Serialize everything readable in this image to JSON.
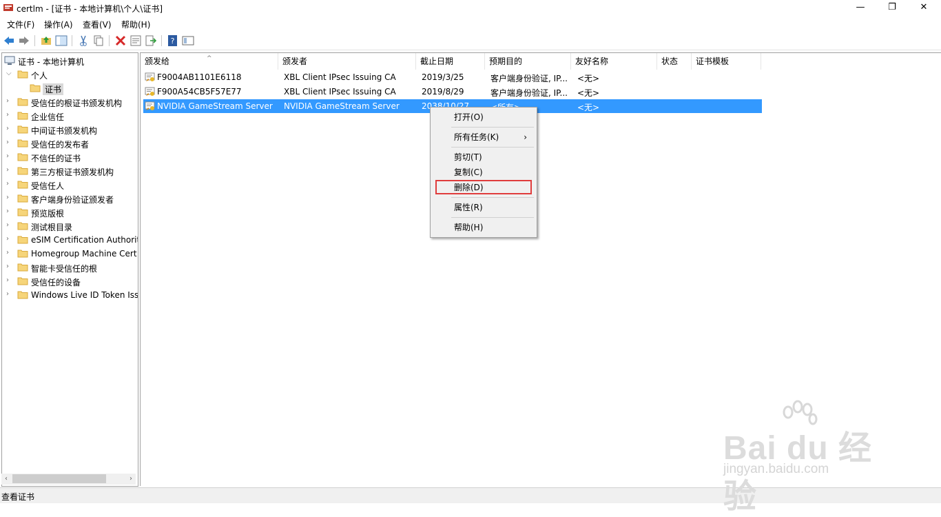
{
  "window": {
    "title": "certlm - [证书 - 本地计算机\\个人\\证书]",
    "minimize_glyph": "—",
    "restore_glyph": "❐",
    "close_glyph": "✕"
  },
  "menu": [
    "文件(F)",
    "操作(A)",
    "查看(V)",
    "帮助(H)"
  ],
  "toolbar": {
    "icons": [
      "back-arrow-icon",
      "forward-arrow-icon",
      "up-folder-icon",
      "show-hide-tree-icon",
      "cut-icon",
      "copy-icon",
      "delete-icon",
      "properties-icon",
      "export-list-icon",
      "help-icon",
      "console-icon"
    ]
  },
  "tree": {
    "root": "证书 - 本地计算机",
    "personal": "个人",
    "certs": "证书",
    "items": [
      "受信任的根证书颁发机构",
      "企业信任",
      "中间证书颁发机构",
      "受信任的发布者",
      "不信任的证书",
      "第三方根证书颁发机构",
      "受信任人",
      "客户端身份验证颁发者",
      "预览版根",
      "测试根目录",
      "eSIM Certification Authorit",
      "Homegroup Machine Cert",
      "智能卡受信任的根",
      "受信任的设备",
      "Windows Live ID Token Iss"
    ]
  },
  "list": {
    "columns": [
      "颁发给",
      "颁发者",
      "截止日期",
      "预期目的",
      "友好名称",
      "状态",
      "证书模板"
    ],
    "rows": [
      {
        "issued_to": "F9004AB1101E6118",
        "issued_by": "XBL Client IPsec Issuing CA",
        "expires": "2019/3/25",
        "purpose": "客户端身份验证, IP...",
        "friendly": "<无>"
      },
      {
        "issued_to": "F900A54CB5F57E77",
        "issued_by": "XBL Client IPsec Issuing CA",
        "expires": "2019/8/29",
        "purpose": "客户端身份验证, IP...",
        "friendly": "<无>"
      },
      {
        "issued_to": "NVIDIA GameStream Server",
        "issued_by": "NVIDIA GameStream Server",
        "expires": "2038/10/27",
        "purpose": "<所有>",
        "friendly": "<无>"
      }
    ]
  },
  "context_menu": {
    "open": "打开(O)",
    "all_tasks": "所有任务(K)",
    "cut": "剪切(T)",
    "copy": "复制(C)",
    "delete": "删除(D)",
    "properties": "属性(R)",
    "help": "帮助(H)",
    "highlight_color": "#e03c3c"
  },
  "status": "查看证书",
  "watermark": {
    "main": "Bai du 经验",
    "sub": "jingyan.baidu.com"
  },
  "colors": {
    "selection": "#3399ff",
    "folder": "#f6d57a"
  }
}
